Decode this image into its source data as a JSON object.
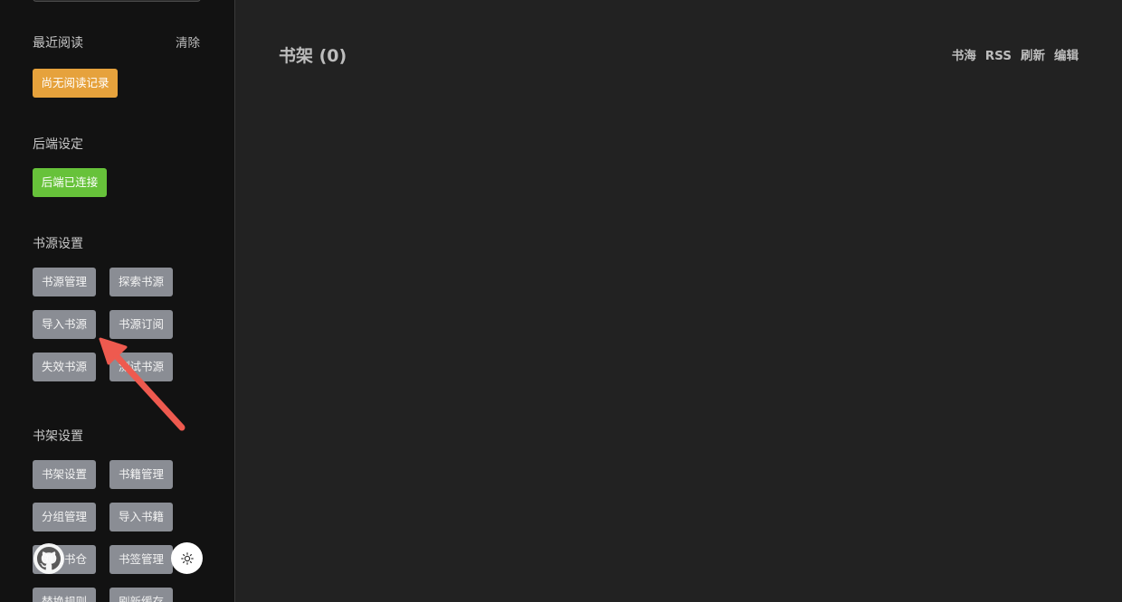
{
  "recent": {
    "title": "最近阅读",
    "clear_label": "清除",
    "empty_label": "尚无阅读记录"
  },
  "backend": {
    "title": "后端设定",
    "status_label": "后端已连接"
  },
  "source_settings": {
    "title": "书源设置",
    "buttons": [
      "书源管理",
      "探索书源",
      "导入书源",
      "书源订阅",
      "失效书源",
      "测试书源"
    ]
  },
  "shelf_settings": {
    "title": "书架设置",
    "buttons": [
      "书架设置",
      "书籍管理",
      "分组管理",
      "导入书籍",
      "浏览书仓",
      "书签管理",
      "替换规则",
      "刷新缓存"
    ]
  },
  "main": {
    "shelf_title": "书架 (0)",
    "nav": [
      "书海",
      "RSS",
      "刷新",
      "编辑"
    ]
  },
  "colors": {
    "sidebar_bg": "#121212",
    "main_bg": "#222222",
    "orange": "#e6a23c",
    "green": "#67c23a",
    "grey_button": "#8a8d94",
    "arrow": "#ee5a4f"
  },
  "icons": {
    "github": "github-icon",
    "theme": "sun-icon"
  }
}
